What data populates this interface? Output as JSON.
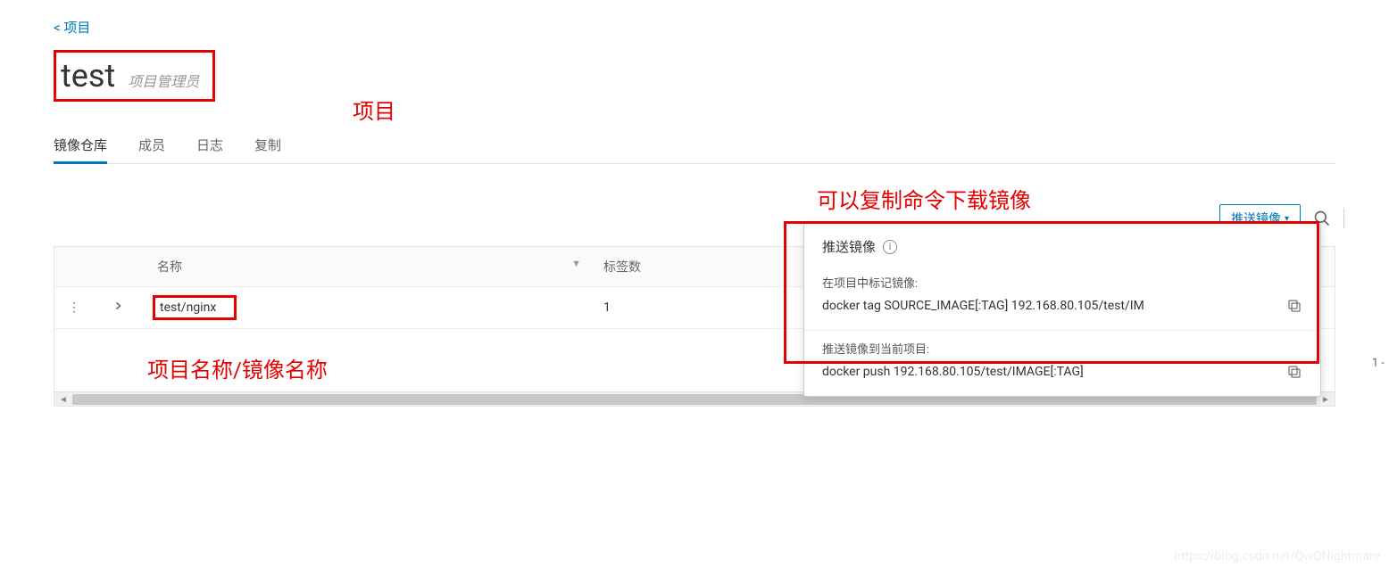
{
  "breadcrumb": {
    "back": "< 项目"
  },
  "header": {
    "project_name": "test",
    "role": "项目管理员"
  },
  "annotations": {
    "project": "项目",
    "copy_hint": "可以复制命令下载镜像",
    "name_hint": "项目名称/镜像名称"
  },
  "tabs": [
    {
      "label": "镜像仓库",
      "active": true
    },
    {
      "label": "成员",
      "active": false
    },
    {
      "label": "日志",
      "active": false
    },
    {
      "label": "复制",
      "active": false
    }
  ],
  "toolbar": {
    "push_button": "推送镜像"
  },
  "table": {
    "columns": {
      "name": "名称",
      "tags": "标签数"
    },
    "rows": [
      {
        "name": "test/nginx",
        "tags": "1"
      }
    ]
  },
  "pagination": {
    "info": "1 -"
  },
  "popover": {
    "title": "推送镜像",
    "sections": [
      {
        "label": "在项目中标记镜像:",
        "command": "docker tag SOURCE_IMAGE[:TAG] 192.168.80.105/test/IM"
      },
      {
        "label": "推送镜像到当前项目:",
        "command": "docker push 192.168.80.105/test/IMAGE[:TAG]"
      }
    ]
  },
  "watermark": "https://blog.csdn.net/QwQNightmare"
}
